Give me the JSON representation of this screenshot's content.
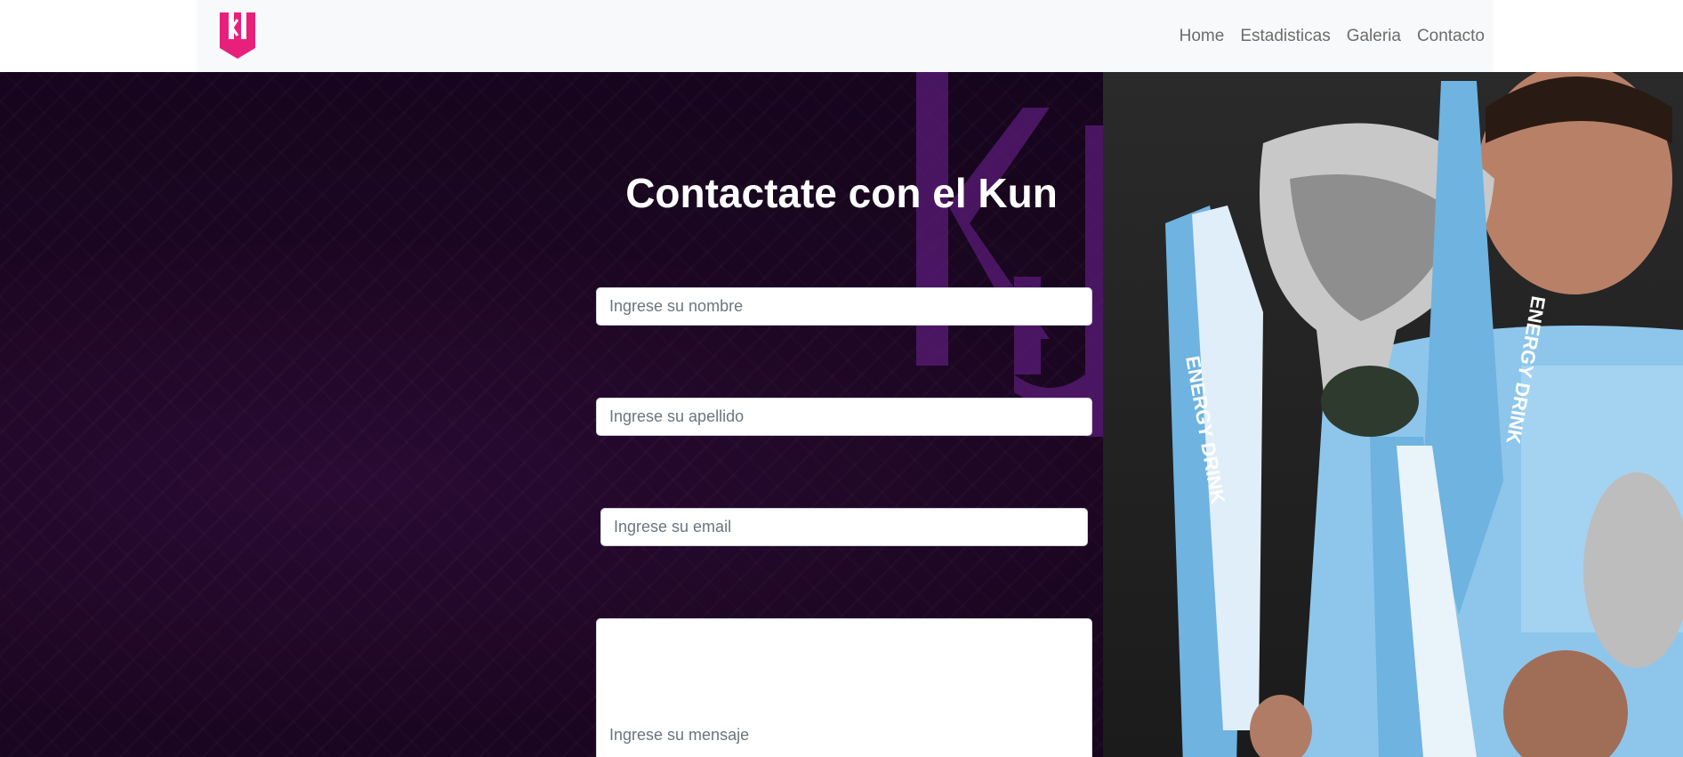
{
  "navbar": {
    "logo_name": "kun-logo",
    "links": [
      {
        "label": "Home"
      },
      {
        "label": "Estadisticas"
      },
      {
        "label": "Galeria"
      },
      {
        "label": "Contacto"
      }
    ]
  },
  "hero": {
    "title": "Contactate con el Kun",
    "watermark_text": "KUN",
    "photo": "Kun Agüero kissing trophy with ENERGY DRINK ribbons"
  },
  "form": {
    "nombre_placeholder": "Ingrese su nombre",
    "apellido_placeholder": "Ingrese su apellido",
    "email_placeholder": "Ingrese su email",
    "mensaje_placeholder": "Ingrese su mensaje"
  },
  "colors": {
    "brand_pink": "#e8207c",
    "hero_bg": "#1a0620",
    "navbar_bg": "#f8f9fa",
    "ribbon_blue": "#6fb3e0",
    "watermark_purple": "#5a1b78"
  }
}
